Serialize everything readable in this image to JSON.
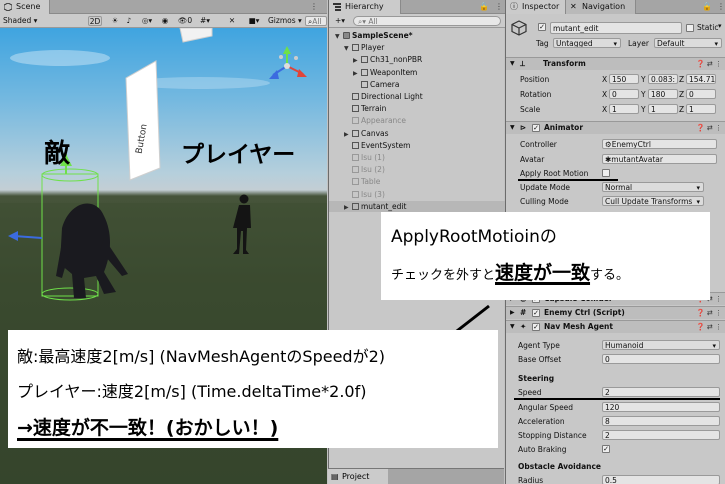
{
  "scene": {
    "tab": "Scene",
    "shading": "Shaded",
    "mode_2d": "2D",
    "gizmos": "Gizmos",
    "search_placeholder": "All",
    "billboard_text": "Button",
    "enemy_label": "敵",
    "player_label": "プレイヤー"
  },
  "hierarchy": {
    "tab": "Hierarchy",
    "add": "+",
    "search_placeholder": "All",
    "items": [
      {
        "label": "SampleScene*",
        "depth": 0,
        "expanded": true,
        "dim": false,
        "scene": true
      },
      {
        "label": "Player",
        "depth": 1,
        "expanded": true,
        "dim": false
      },
      {
        "label": "Ch31_nonPBR",
        "depth": 2,
        "expanded": false,
        "dim": false
      },
      {
        "label": "WeaponItem",
        "depth": 2,
        "expanded": false,
        "dim": false
      },
      {
        "label": "Camera",
        "depth": 2,
        "expanded": null,
        "dim": false
      },
      {
        "label": "Directional Light",
        "depth": 1,
        "expanded": null,
        "dim": false
      },
      {
        "label": "Terrain",
        "depth": 1,
        "expanded": null,
        "dim": false
      },
      {
        "label": "Appearance",
        "depth": 1,
        "expanded": null,
        "dim": true
      },
      {
        "label": "Canvas",
        "depth": 1,
        "expanded": false,
        "dim": false
      },
      {
        "label": "EventSystem",
        "depth": 1,
        "expanded": null,
        "dim": false
      },
      {
        "label": "Isu (1)",
        "depth": 1,
        "expanded": null,
        "dim": true
      },
      {
        "label": "Isu (2)",
        "depth": 1,
        "expanded": null,
        "dim": true
      },
      {
        "label": "Table",
        "depth": 1,
        "expanded": null,
        "dim": true
      },
      {
        "label": "Isu (3)",
        "depth": 1,
        "expanded": null,
        "dim": true
      },
      {
        "label": "mutant_edit",
        "depth": 1,
        "expanded": false,
        "dim": false,
        "selected": true
      }
    ]
  },
  "project": {
    "tab": "Project"
  },
  "inspector": {
    "tab_inspector": "Inspector",
    "tab_navigation": "Navigation",
    "object_name": "mutant_edit",
    "static_label": "Static",
    "tag_label": "Tag",
    "tag_value": "Untagged",
    "layer_label": "Layer",
    "layer_value": "Default",
    "transform": {
      "title": "Transform",
      "position_label": "Position",
      "rotation_label": "Rotation",
      "scale_label": "Scale",
      "position": {
        "x": "150",
        "y": "0.083:",
        "z": "154.71"
      },
      "rotation": {
        "x": "0",
        "y": "180",
        "z": "0"
      },
      "scale": {
        "x": "1",
        "y": "1",
        "z": "1"
      }
    },
    "animator": {
      "title": "Animator",
      "controller_label": "Controller",
      "controller_value": "EnemyCtrl",
      "avatar_label": "Avatar",
      "avatar_value": "mutantAvatar",
      "apply_root_motion_label": "Apply Root Motion",
      "update_mode_label": "Update Mode",
      "update_mode_value": "Normal",
      "culling_mode_label": "Culling Mode",
      "culling_mode_value": "Cull Update Transforms"
    },
    "capsule_collider": {
      "title": "Capsule Collider"
    },
    "enemy_ctrl": {
      "title": "Enemy Ctrl (Script)"
    },
    "nav_mesh_agent": {
      "title": "Nav Mesh Agent",
      "agent_type_label": "Agent Type",
      "agent_type_value": "Humanoid",
      "base_offset_label": "Base Offset",
      "base_offset_value": "0",
      "steering_label": "Steering",
      "speed_label": "Speed",
      "speed_value": "2",
      "angular_speed_label": "Angular Speed",
      "angular_speed_value": "120",
      "acceleration_label": "Acceleration",
      "acceleration_value": "8",
      "stopping_distance_label": "Stopping Distance",
      "stopping_distance_value": "2",
      "auto_braking_label": "Auto Braking",
      "obstacle_avoidance_label": "Obstacle Avoidance",
      "radius_label": "Radius",
      "radius_value": "0.5"
    }
  },
  "callout_right": {
    "line1": "ApplyRootMotioinの",
    "line2_prefix": "チェックを外すと",
    "line2_bold": "速度が一致",
    "line2_suffix": "する。"
  },
  "callout_bottom": {
    "line1": "敵:最高速度2[m/s] (NavMeshAgentのSpeedが2)",
    "line2": "プレイヤー:速度2[m/s] (Time.deltaTime*2.0f)",
    "line3": "→速度が不一致！(おかしい！)"
  },
  "colors": {
    "sky": "#3fa4e0",
    "ground": "#3b4a30",
    "panel": "#c8c8c8",
    "selection_outline": "#6fe04a",
    "axis_y": "#6fe04a",
    "axis_x": "#e0443a",
    "axis_z": "#3b6be0"
  },
  "icons": [
    "scene-icon",
    "hierarchy-icon",
    "inspector-icon",
    "navigation-icon",
    "lock-icon",
    "kebab-icon",
    "gameobject-cube-icon",
    "transform-icon",
    "animator-icon",
    "capsule-collider-icon",
    "script-icon",
    "navmesh-icon",
    "help-icon",
    "settings-icon",
    "search-icon",
    "orientation-gizmo-icon",
    "project-icon"
  ]
}
